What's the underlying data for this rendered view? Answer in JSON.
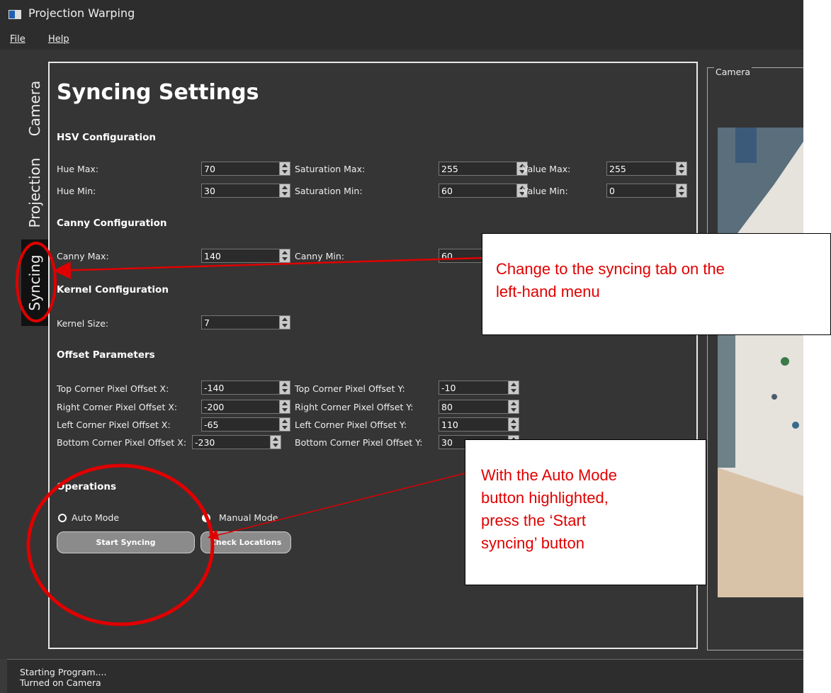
{
  "window": {
    "title": "Projection Warping"
  },
  "menu": {
    "file": "File",
    "help": "Help"
  },
  "side_tabs": [
    {
      "label": "Camera"
    },
    {
      "label": "Projection"
    },
    {
      "label": "Syncing"
    }
  ],
  "page_title": "Syncing Settings",
  "hsv": {
    "heading": "HSV Configuration",
    "hue_max_label": "Hue Max:",
    "hue_max": "70",
    "hue_min_label": "Hue Min:",
    "hue_min": "30",
    "sat_max_label": "Saturation Max:",
    "sat_max": "255",
    "sat_min_label": "Saturation Min:",
    "sat_min": "60",
    "val_max_label": "Value Max:",
    "val_max": "255",
    "val_min_label": "Value Min:",
    "val_min": "0"
  },
  "canny": {
    "heading": "Canny Configuration",
    "max_label": "Canny Max:",
    "max": "140",
    "min_label": "Canny Min:",
    "min": "60"
  },
  "kernel": {
    "heading": "Kernel Configuration",
    "size_label": "Kernel Size:",
    "size": "7"
  },
  "offsets": {
    "heading": "Offset Parameters",
    "top_x_label": "Top Corner Pixel Offset X:",
    "top_x": "-140",
    "top_y_label": "Top Corner Pixel Offset Y:",
    "top_y": "-10",
    "right_x_label": "Right Corner Pixel Offset X:",
    "right_x": "-200",
    "right_y_label": "Right Corner Pixel Offset Y:",
    "right_y": "80",
    "left_x_label": "Left Corner Pixel Offset X:",
    "left_x": "-65",
    "left_y_label": "Left Corner Pixel Offset Y:",
    "left_y": "110",
    "bottom_x_label": "Bottom Corner Pixel Offset X:",
    "bottom_x": "-230",
    "bottom_y_label": "Bottom Corner Pixel Offset Y:",
    "bottom_y": "30"
  },
  "operations": {
    "heading": "Operations",
    "auto_mode": "Auto Mode",
    "manual_mode": "Manual Mode",
    "start_syncing": "Start Syncing",
    "check_locations": "Check Locations"
  },
  "camera_group": {
    "label": "Camera"
  },
  "status_log": [
    "Starting Program....",
    "Turned on Camera"
  ],
  "annotations": {
    "callout_1_line1": "Change to the syncing tab on the",
    "callout_1_line2": "left-hand menu",
    "callout_2_line1": "With the Auto Mode",
    "callout_2_line2": "button highlighted,",
    "callout_2_line3": "press the ‘Start",
    "callout_2_line4": "syncing’ button",
    "color": "#e00000"
  }
}
